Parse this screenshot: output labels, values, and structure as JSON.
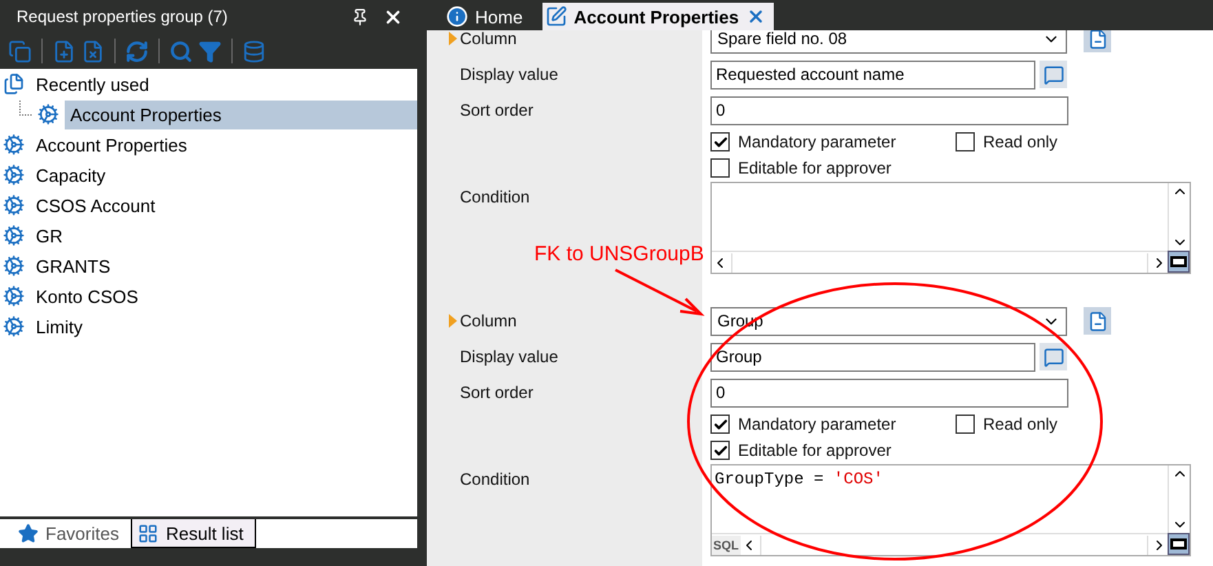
{
  "left_panel": {
    "title": "Request properties group (7)",
    "tree": [
      {
        "label": "Recently used",
        "kind": "folder",
        "selected": false,
        "children": [
          {
            "label": "Account Properties",
            "kind": "property",
            "selected": true
          }
        ]
      },
      {
        "label": "Account Properties",
        "kind": "property",
        "selected": false
      },
      {
        "label": "Capacity",
        "kind": "property",
        "selected": false
      },
      {
        "label": "CSOS Account",
        "kind": "property",
        "selected": false
      },
      {
        "label": "GR",
        "kind": "property",
        "selected": false
      },
      {
        "label": "GRANTS",
        "kind": "property",
        "selected": false
      },
      {
        "label": "Konto CSOS",
        "kind": "property",
        "selected": false
      },
      {
        "label": "Limity",
        "kind": "property",
        "selected": false
      }
    ],
    "bottom_tabs": [
      {
        "label": "Favorites",
        "kind": "star",
        "selected": false
      },
      {
        "label": "Result list",
        "kind": "grid",
        "selected": true
      }
    ]
  },
  "tabs": [
    {
      "label": "Home",
      "kind": "info",
      "selected": false
    },
    {
      "label": "Account Properties",
      "kind": "edit",
      "selected": true
    }
  ],
  "parameters": [
    {
      "current": true,
      "column_label": "Column",
      "column": "Spare field no. 08",
      "display_label": "Display value",
      "display_value": "Requested account name",
      "sort_label": "Sort order",
      "sort_order": "0",
      "mandatory_label": "Mandatory parameter",
      "mandatory": true,
      "read_only_label": "Read only",
      "read_only": false,
      "editable_label": "Editable for approver",
      "editable": false,
      "condition_label": "Condition"
    },
    {
      "current": true,
      "column_label": "Column",
      "column": "Group",
      "display_label": "Display value",
      "display_value": "Group",
      "sort_label": "Sort order",
      "sort_order": "0",
      "mandatory_label": "Mandatory parameter",
      "mandatory": true,
      "read_only_label": "Read only",
      "read_only": false,
      "editable_label": "Editable for approver",
      "editable": true,
      "condition_label": "Condition",
      "condition": [
        {
          "text": "GroupType = ",
          "kind": "plain"
        },
        {
          "text": "'COS'",
          "kind": "string"
        }
      ],
      "sql_badge": "SQL"
    }
  ],
  "annotation": {
    "text": "FK to UNSGroupB"
  }
}
